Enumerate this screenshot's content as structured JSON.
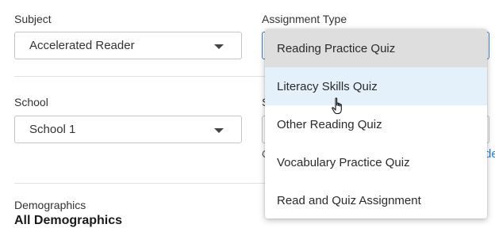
{
  "subject": {
    "label": "Subject",
    "value": "Accelerated Reader"
  },
  "assignment_type": {
    "label": "Assignment Type",
    "options": [
      "Reading Practice Quiz",
      "Literacy Skills Quiz",
      "Other Reading Quiz",
      "Vocabulary Practice Quiz",
      "Read and Quiz Assignment"
    ],
    "selected": "Reading Practice Quiz",
    "hovered": "Literacy Skills Quiz"
  },
  "school": {
    "label": "School",
    "value": "School 1"
  },
  "partial": {
    "second_label_char": "S",
    "hint_char": "C",
    "link_chars": "de"
  },
  "demographics": {
    "label": "Demographics",
    "value": "All Demographics"
  },
  "colors": {
    "focus_border": "#3f7fbf",
    "hover_bg": "#e4f1fb",
    "selected_bg": "#dedede",
    "link": "#2c7fc4"
  }
}
